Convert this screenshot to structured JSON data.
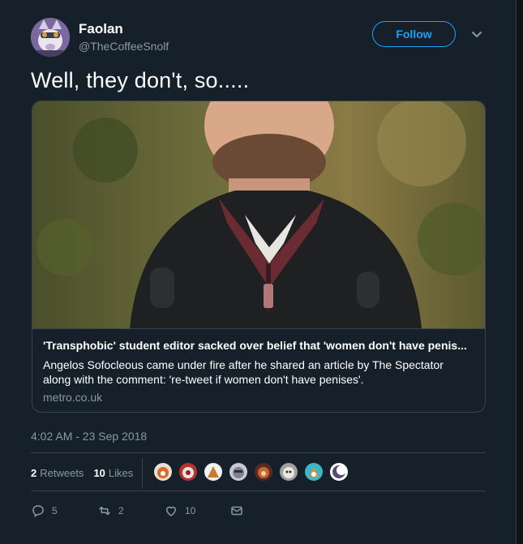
{
  "author": {
    "name": "Faolan",
    "handle": "@TheCoffeeSnolf"
  },
  "follow_button": "Follow",
  "tweet": {
    "text": "Well, they don't, so....."
  },
  "card": {
    "title": "'Transphobic' student editor sacked over belief that 'women don't have penis...",
    "description": "Angelos Sofocleous came under fire after he shared an article by The Spectator along with the comment: 're-tweet if women don't have penises'.",
    "domain": "metro.co.uk"
  },
  "timestamp": "4:02 AM - 23 Sep 2018",
  "stats": {
    "retweets_count": "2",
    "retweets_label": "Retweets",
    "likes_count": "10",
    "likes_label": "Likes"
  },
  "actions": {
    "reply_count": "5",
    "retweet_count": "2",
    "like_count": "10"
  },
  "colors": {
    "background": "#15202b",
    "accent": "#1da1f2",
    "secondary_text": "#8899a6",
    "border": "#38444d"
  },
  "icons": [
    "caret-down-icon",
    "reply-icon",
    "retweet-icon",
    "like-icon",
    "message-icon"
  ]
}
